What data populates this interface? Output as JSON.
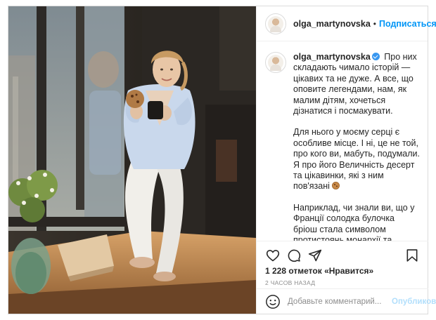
{
  "post": {
    "author": {
      "username": "olga_martynovska",
      "verified": true,
      "follow_label": "Подписаться",
      "more_label": "•••"
    },
    "photo": {
      "description_icon": "woman-with-cookie-photo"
    },
    "caption": {
      "username": "olga_martynovska",
      "paragraphs": [
        "Про них складають чимало історій — цікавих та не дуже. А все, що оповите легендами, нам, як малим дітям, хочеться дізнатися і посмакувати.",
        "Для нього у моєму серці є особливе місце. І ні, це не той, про кого ви, мабуть, подумали. Я про його Величність десерт та цікавинки, які з ним пов'язані",
        "Наприклад, чи знали ви, що у Франції солодка булочка бріош стала символом протистоянь монархії та народу? Так-так, знаменита фраза «Qu'ils mangent de la brioche» («Нехай їдять тістечка») — це уособлення всього, що"
      ]
    },
    "actions": {
      "like_icon": "heart-icon",
      "comment_icon": "comment-icon",
      "share_icon": "share-icon",
      "save_icon": "bookmark-icon"
    },
    "likes": {
      "count": "1 228",
      "text": "отметок «Нравится»"
    },
    "time_ago": "2 ЧАСОВ НАЗАД",
    "comment_box": {
      "placeholder": "Добавьте комментарий...",
      "publish_label": "Опубликовать"
    }
  },
  "colors": {
    "accent": "#0095f6",
    "publish_disabled": "#b2dffc",
    "border": "#dbdbdb",
    "secondary_text": "#8e8e8e"
  }
}
